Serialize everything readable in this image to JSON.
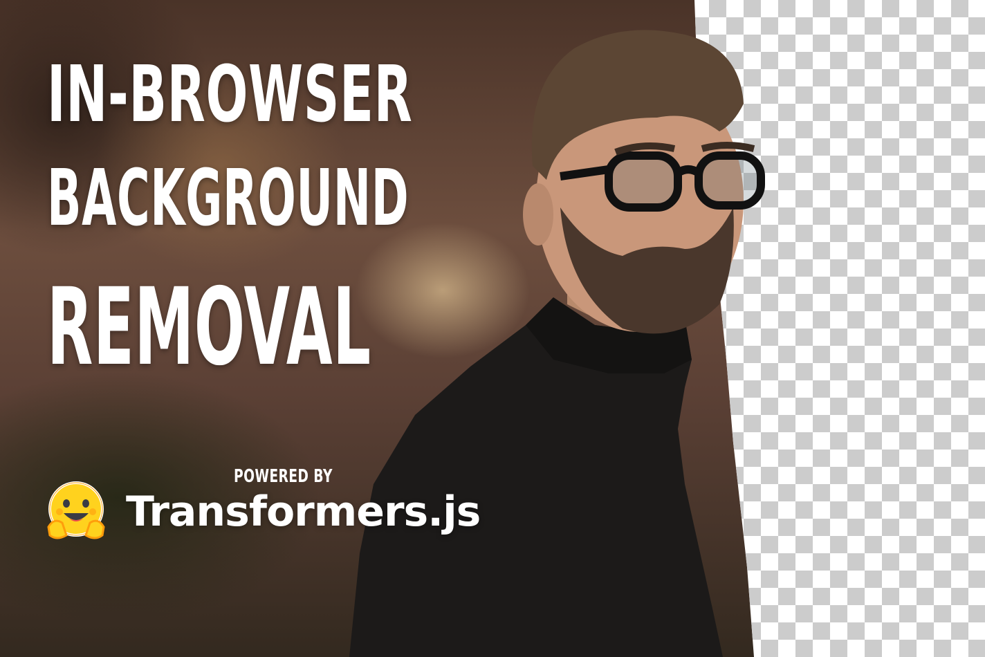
{
  "headline": {
    "line1": "IN-BROWSER",
    "line2": "BACKGROUND",
    "line3": "REMOVAL"
  },
  "credit": {
    "powered_by": "POWERED BY",
    "brand": "Transformers.js",
    "logo_icon": "hugging-face-emoji-icon"
  },
  "colors": {
    "text": "#ffffff",
    "checker_light": "#ffffff",
    "checker_dark": "#cccccc",
    "logo_yellow": "#ffd21e",
    "logo_orange": "#ff9d0b"
  }
}
